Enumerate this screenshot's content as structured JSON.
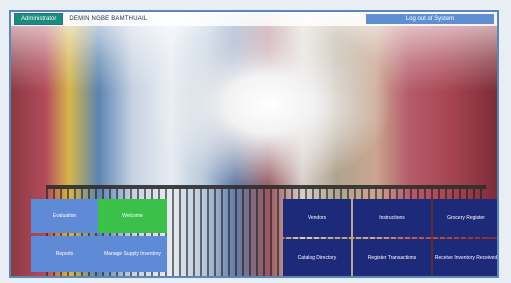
{
  "header": {
    "admin_tab_label": "Administrator",
    "user_info": "DEMIN NGBE BAMTHUAIL",
    "logout_label": "Log out of System"
  },
  "left_buttons": [
    {
      "label": "Evaluation"
    },
    {
      "label": "Welcome"
    },
    {
      "label": "Reports"
    },
    {
      "label": "Manage Supply Inventory"
    }
  ],
  "right_buttons": [
    {
      "label": "Vendors"
    },
    {
      "label": "Instructions"
    },
    {
      "label": "Grocery Register"
    },
    {
      "label": "Catalog Directory"
    },
    {
      "label": "Register Transactions"
    },
    {
      "label": "Receive Inventory Received"
    }
  ],
  "colors": {
    "light_blue": "#5f8bd6",
    "green": "#3bc14a",
    "navy": "#1d2a7a",
    "teal_tab": "#1a8c7c"
  }
}
